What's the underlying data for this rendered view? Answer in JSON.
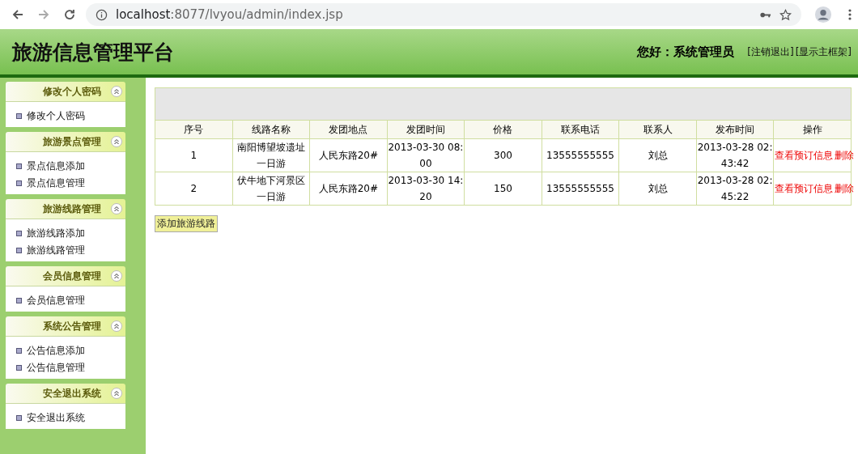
{
  "browser": {
    "url_host": "localhost",
    "url_rest": ":8077/lvyou/admin/index.jsp"
  },
  "header": {
    "title": "旅游信息管理平台",
    "greeting": "您好：系统管理员",
    "links": [
      "[注销退出]",
      "[显示主框架]"
    ]
  },
  "sidebar": [
    {
      "title": "修改个人密码",
      "items": [
        "修改个人密码"
      ]
    },
    {
      "title": "旅游景点管理",
      "items": [
        "景点信息添加",
        "景点信息管理"
      ]
    },
    {
      "title": "旅游线路管理",
      "items": [
        "旅游线路添加",
        "旅游线路管理"
      ]
    },
    {
      "title": "会员信息管理",
      "items": [
        "会员信息管理"
      ]
    },
    {
      "title": "系统公告管理",
      "items": [
        "公告信息添加",
        "公告信息管理"
      ]
    },
    {
      "title": "安全退出系统",
      "items": [
        "安全退出系统"
      ]
    }
  ],
  "table": {
    "columns": [
      "序号",
      "线路名称",
      "发团地点",
      "发团时间",
      "价格",
      "联系电话",
      "联系人",
      "发布时间",
      "操作"
    ],
    "rows": [
      {
        "cells": [
          "1",
          "南阳博望坡遗址一日游",
          "人民东路20#",
          "2013-03-30 08:00",
          "300",
          "13555555555",
          "刘总",
          "2013-03-28 02:43:42"
        ],
        "actions": [
          "查看预订信息",
          "删除"
        ]
      },
      {
        "cells": [
          "2",
          "伏牛地下河景区一日游",
          "人民东路20#",
          "2013-03-30 14:20",
          "150",
          "13555555555",
          "刘总",
          "2013-03-28 02:45:22"
        ],
        "actions": [
          "查看预订信息",
          "删除"
        ]
      }
    ]
  },
  "add_button": "添加旅游线路"
}
